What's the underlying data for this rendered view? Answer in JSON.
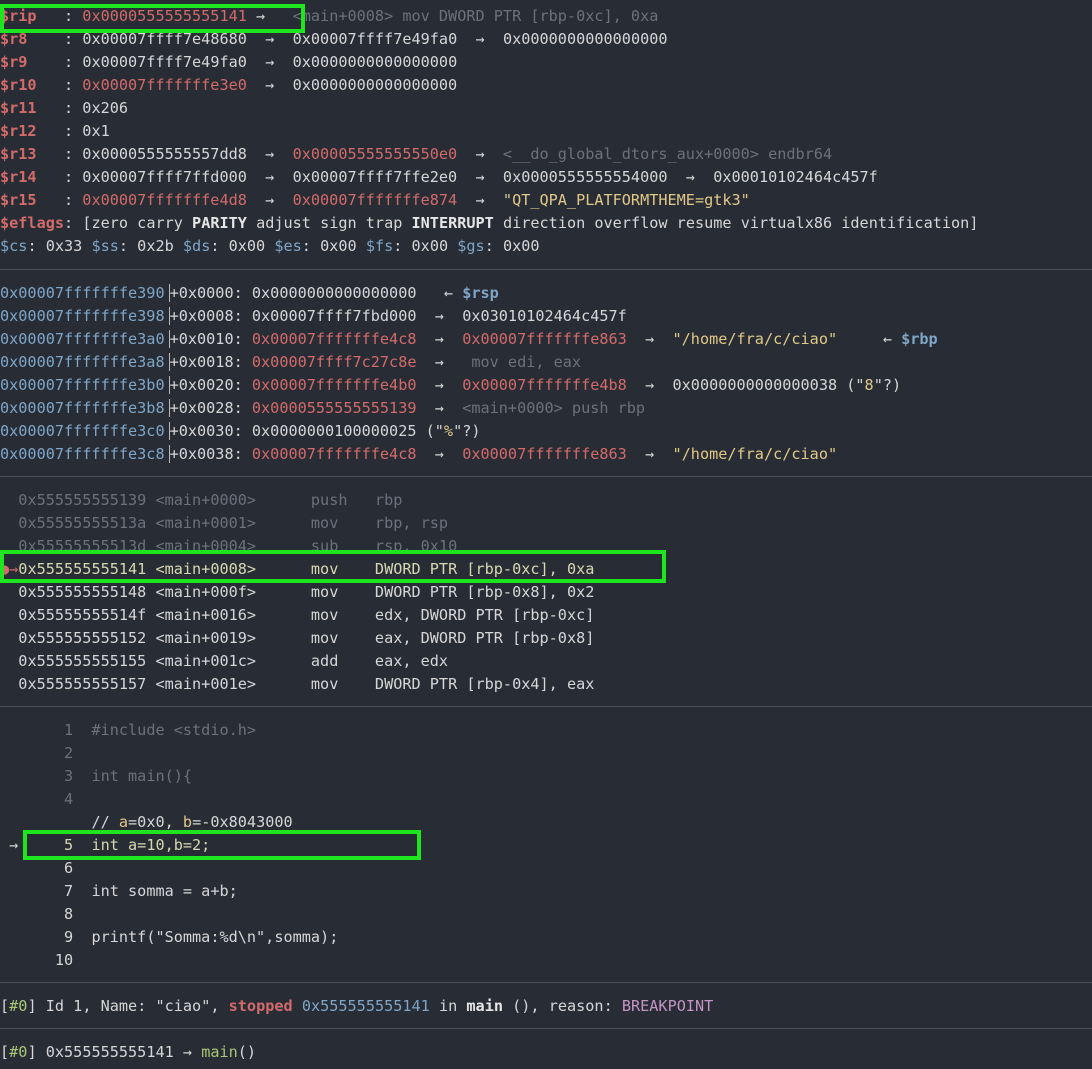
{
  "registers": [
    {
      "name": "$rip",
      "sep": "   : ",
      "chain": [
        {
          "t": "0x0000555555555141",
          "c": "red"
        },
        {
          "t": " → ",
          "c": "white"
        },
        {
          "t": "  <main+0008> mov DWORD PTR [rbp-0xc], 0xa",
          "c": "dim"
        }
      ]
    },
    {
      "name": "$r8",
      "sep": "    : ",
      "chain": [
        {
          "t": "0x00007ffff7e48680",
          "c": "white"
        },
        {
          "t": "  →  ",
          "c": "white"
        },
        {
          "t": "0x00007ffff7e49fa0",
          "c": "white"
        },
        {
          "t": "  →  ",
          "c": "white"
        },
        {
          "t": "0x0000000000000000",
          "c": "white"
        }
      ]
    },
    {
      "name": "$r9",
      "sep": "    : ",
      "chain": [
        {
          "t": "0x00007ffff7e49fa0",
          "c": "white"
        },
        {
          "t": "  →  ",
          "c": "white"
        },
        {
          "t": "0x0000000000000000",
          "c": "white"
        }
      ]
    },
    {
      "name": "$r10",
      "sep": "   : ",
      "chain": [
        {
          "t": "0x00007fffffffe3e0",
          "c": "red"
        },
        {
          "t": "  →  ",
          "c": "white"
        },
        {
          "t": "0x0000000000000000",
          "c": "white"
        }
      ]
    },
    {
      "name": "$r11",
      "sep": "   : ",
      "chain": [
        {
          "t": "0x206",
          "c": "white"
        }
      ]
    },
    {
      "name": "$r12",
      "sep": "   : ",
      "chain": [
        {
          "t": "0x1",
          "c": "white"
        }
      ]
    },
    {
      "name": "$r13",
      "sep": "   : ",
      "chain": [
        {
          "t": "0x0000555555557dd8",
          "c": "white"
        },
        {
          "t": "  →  ",
          "c": "white"
        },
        {
          "t": "0x00005555555550e0",
          "c": "red"
        },
        {
          "t": "  →  ",
          "c": "white"
        },
        {
          "t": "<__do_global_dtors_aux+0000> endbr64",
          "c": "dim"
        }
      ]
    },
    {
      "name": "$r14",
      "sep": "   : ",
      "chain": [
        {
          "t": "0x00007ffff7ffd000",
          "c": "white"
        },
        {
          "t": "  →  ",
          "c": "white"
        },
        {
          "t": "0x00007ffff7ffe2e0",
          "c": "white"
        },
        {
          "t": "  →  ",
          "c": "white"
        },
        {
          "t": "0x0000555555554000",
          "c": "white"
        },
        {
          "t": "  →  ",
          "c": "white"
        },
        {
          "t": "0x00010102464c457f",
          "c": "white"
        }
      ]
    },
    {
      "name": "$r15",
      "sep": "   : ",
      "chain": [
        {
          "t": "0x00007fffffffe4d8",
          "c": "red"
        },
        {
          "t": "  →  ",
          "c": "white"
        },
        {
          "t": "0x00007fffffffe874",
          "c": "red"
        },
        {
          "t": "  →  ",
          "c": "white"
        },
        {
          "t": "\"QT_QPA_PLATFORMTHEME=gtk3\"",
          "c": "yel"
        }
      ]
    }
  ],
  "eflags": {
    "name": "$eflags",
    "sep": ": ",
    "flags": [
      {
        "t": "[zero carry ",
        "c": "white"
      },
      {
        "t": "PARITY",
        "c": "bold"
      },
      {
        "t": " adjust sign trap ",
        "c": "white"
      },
      {
        "t": "INTERRUPT",
        "c": "bold"
      },
      {
        "t": " direction overflow resume virtualx86 identification]",
        "c": "white"
      }
    ]
  },
  "segments": [
    {
      "name": "$cs",
      "value": "0x33"
    },
    {
      "name": "$ss",
      "value": "0x2b"
    },
    {
      "name": "$ds",
      "value": "0x00"
    },
    {
      "name": "$es",
      "value": "0x00"
    },
    {
      "name": "$fs",
      "value": "0x00"
    },
    {
      "name": "$gs",
      "value": "0x00"
    }
  ],
  "stack": [
    {
      "addr": "0x00007fffffffe390",
      "off": "+0x0000",
      "chain": [
        {
          "t": "0x0000000000000000",
          "c": "white"
        },
        {
          "t": "   ← ",
          "c": "white"
        },
        {
          "t": "$rsp",
          "c": "blueb"
        }
      ]
    },
    {
      "addr": "0x00007fffffffe398",
      "off": "+0x0008",
      "chain": [
        {
          "t": "0x00007ffff7fbd000",
          "c": "white"
        },
        {
          "t": "  →  ",
          "c": "white"
        },
        {
          "t": "0x03010102464c457f",
          "c": "white"
        }
      ]
    },
    {
      "addr": "0x00007fffffffe3a0",
      "off": "+0x0010",
      "chain": [
        {
          "t": "0x00007fffffffe4c8",
          "c": "red"
        },
        {
          "t": "  →  ",
          "c": "white"
        },
        {
          "t": "0x00007fffffffe863",
          "c": "red"
        },
        {
          "t": "  →  ",
          "c": "white"
        },
        {
          "t": "\"/home/fra/c/ciao\"",
          "c": "yel"
        },
        {
          "t": "     ← ",
          "c": "white"
        },
        {
          "t": "$rbp",
          "c": "blueb"
        }
      ]
    },
    {
      "addr": "0x00007fffffffe3a8",
      "off": "+0x0018",
      "chain": [
        {
          "t": "0x00007ffff7c27c8e",
          "c": "red"
        },
        {
          "t": "  →  ",
          "c": "white"
        },
        {
          "t": " mov edi, eax",
          "c": "dim"
        }
      ]
    },
    {
      "addr": "0x00007fffffffe3b0",
      "off": "+0x0020",
      "chain": [
        {
          "t": "0x00007fffffffe4b0",
          "c": "red"
        },
        {
          "t": "  →  ",
          "c": "white"
        },
        {
          "t": "0x00007fffffffe4b8",
          "c": "red"
        },
        {
          "t": "  →  ",
          "c": "white"
        },
        {
          "t": "0x0000000000000038 (\"",
          "c": "white"
        },
        {
          "t": "8",
          "c": "yel"
        },
        {
          "t": "\"?)",
          "c": "white"
        }
      ]
    },
    {
      "addr": "0x00007fffffffe3b8",
      "off": "+0x0028",
      "chain": [
        {
          "t": "0x0000555555555139",
          "c": "red"
        },
        {
          "t": "  →  ",
          "c": "white"
        },
        {
          "t": "<main+0000> push rbp",
          "c": "dim"
        }
      ]
    },
    {
      "addr": "0x00007fffffffe3c0",
      "off": "+0x0030",
      "chain": [
        {
          "t": "0x0000000100000025 (\"",
          "c": "white"
        },
        {
          "t": "%",
          "c": "yel"
        },
        {
          "t": "\"?)",
          "c": "white"
        }
      ]
    },
    {
      "addr": "0x00007fffffffe3c8",
      "off": "+0x0038",
      "chain": [
        {
          "t": "0x00007fffffffe4c8",
          "c": "red"
        },
        {
          "t": "  →  ",
          "c": "white"
        },
        {
          "t": "0x00007fffffffe863",
          "c": "red"
        },
        {
          "t": "  →  ",
          "c": "white"
        },
        {
          "t": "\"/home/fra/c/ciao\"",
          "c": "yel"
        }
      ]
    }
  ],
  "disasm": [
    {
      "marker": "  ",
      "addr": "0x555555555139",
      "sym": "<main+0000>",
      "op": "push",
      "args": "rbp",
      "state": "past"
    },
    {
      "marker": "  ",
      "addr": "0x55555555513a",
      "sym": "<main+0001>",
      "op": "mov",
      "args": "rbp, rsp",
      "state": "past"
    },
    {
      "marker": "  ",
      "addr": "0x55555555513d",
      "sym": "<main+0004>",
      "op": "sub",
      "args": "rsp, 0x10",
      "state": "past"
    },
    {
      "marker": "●→",
      "addr": "0x555555555141",
      "sym": "<main+0008>",
      "op": "mov",
      "args": "DWORD PTR [rbp-0xc], 0xa",
      "state": "current"
    },
    {
      "marker": "  ",
      "addr": "0x555555555148",
      "sym": "<main+000f>",
      "op": "mov",
      "args": "DWORD PTR [rbp-0x8], 0x2",
      "state": "next"
    },
    {
      "marker": "  ",
      "addr": "0x55555555514f",
      "sym": "<main+0016>",
      "op": "mov",
      "args": "edx, DWORD PTR [rbp-0xc]",
      "state": "next"
    },
    {
      "marker": "  ",
      "addr": "0x555555555152",
      "sym": "<main+0019>",
      "op": "mov",
      "args": "eax, DWORD PTR [rbp-0x8]",
      "state": "next"
    },
    {
      "marker": "  ",
      "addr": "0x555555555155",
      "sym": "<main+001c>",
      "op": "add",
      "args": "eax, edx",
      "state": "next"
    },
    {
      "marker": "  ",
      "addr": "0x555555555157",
      "sym": "<main+001e>",
      "op": "mov",
      "args": "DWORD PTR [rbp-0x4], eax",
      "state": "next"
    }
  ],
  "source": [
    {
      "num": "1",
      "code": "#include <stdio.h>",
      "state": "past"
    },
    {
      "num": "2",
      "code": "",
      "state": "past"
    },
    {
      "num": "3",
      "code": "int main(){",
      "state": "past"
    },
    {
      "num": "4",
      "code": "",
      "state": "past"
    },
    {
      "num": "",
      "code": "",
      "state": "comment"
    },
    {
      "num": "5",
      "code": "int a=10,b=2;",
      "state": "current"
    },
    {
      "num": "6",
      "code": "",
      "state": "next"
    },
    {
      "num": "7",
      "code": "int somma = a+b;",
      "state": "next"
    },
    {
      "num": "8",
      "code": "",
      "state": "next"
    },
    {
      "num": "9",
      "code": "printf(\"Somma:%d\\n\",somma);",
      "state": "next"
    },
    {
      "num": "10",
      "code": "",
      "state": "next"
    }
  ],
  "source_comment": {
    "prefix": "// ",
    "a_label": "a",
    "a_val": "=0x0, ",
    "b_label": "b",
    "b_val": "=-0x8043000"
  },
  "source_marker": "→",
  "threads": {
    "id": "#0",
    "text1": " Id 1, Name: \"ciao\", ",
    "state": "stopped",
    "addr": "0x555555555141",
    "text2": " in ",
    "func": "main",
    "text3": " (), reason: ",
    "reason": "BREAKPOINT"
  },
  "trace": {
    "id": "#0",
    "addr": "0x555555555141",
    "arrow": " → ",
    "func": "main",
    "args": "()"
  }
}
